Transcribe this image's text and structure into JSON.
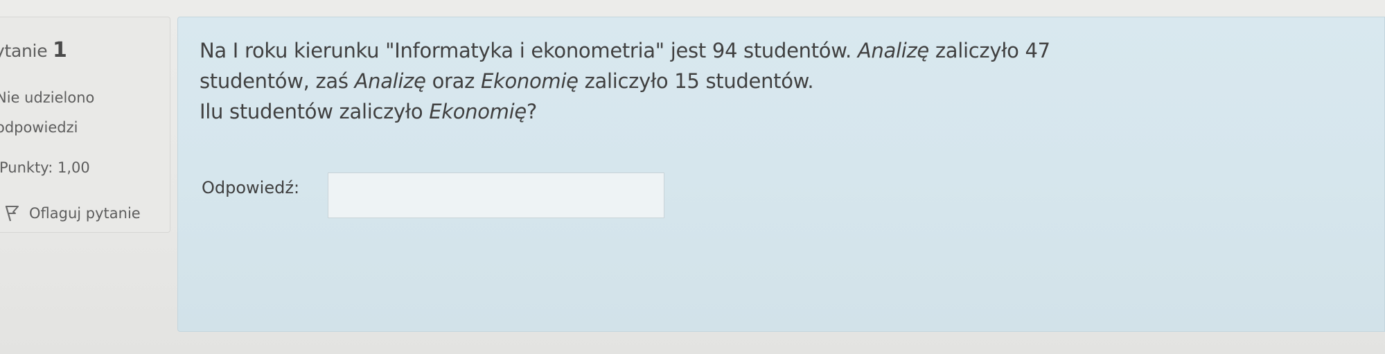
{
  "question_info": {
    "label_fragment": "ytanie",
    "number": "1",
    "state_line1": "Nie udzielono",
    "state_line2": "odpowiedzi",
    "grade": "Punkty: 1,00",
    "flag_label": "Oflaguj pytanie",
    "flag_icon": "flag-icon"
  },
  "question": {
    "line1_a": "Na I roku kierunku \"Informatyka i ekonometria\" jest 94 studentów. ",
    "line1_b_italic": "Analizę",
    "line1_c": " zaliczyło 47",
    "line2_a": "studentów, zaś ",
    "line2_b_italic": "Analizę",
    "line2_c": " oraz ",
    "line2_d_italic": "Ekonomię",
    "line2_e": " zaliczyło 15 studentów.",
    "line3_a": "Ilu studentów zaliczyło ",
    "line3_b_italic": "Ekonomię",
    "line3_c": "?"
  },
  "answer": {
    "label": "Odpowiedź:",
    "value": ""
  },
  "colors": {
    "info_background": "#e9e9e7",
    "content_background": "#d9e8ef",
    "text": "#404040"
  }
}
